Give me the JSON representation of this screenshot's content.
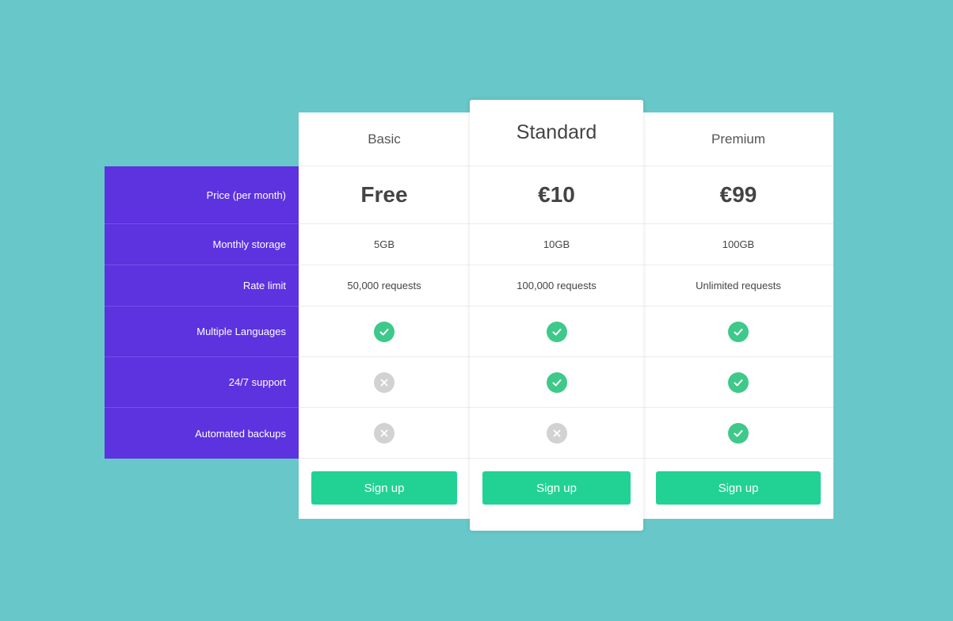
{
  "colors": {
    "background": "#68c7c8",
    "label_column": "#5d32df",
    "cta": "#22d294",
    "check": "#3ec98a",
    "cross": "#d2d2d2"
  },
  "feature_labels": {
    "price": "Price (per month)",
    "storage": "Monthly storage",
    "rate_limit": "Rate limit",
    "languages": "Multiple Languages",
    "support": "24/7 support",
    "backups": "Automated backups"
  },
  "plans": {
    "basic": {
      "name": "Basic",
      "price": "Free",
      "storage": "5GB",
      "rate_limit": "50,000 requests",
      "languages": "check-icon",
      "support": "cross-icon",
      "backups": "cross-icon",
      "cta_label": "Sign up"
    },
    "standard": {
      "name": "Standard",
      "price": "€10",
      "storage": "10GB",
      "rate_limit": "100,000 requests",
      "languages": "check-icon",
      "support": "check-icon",
      "backups": "cross-icon",
      "cta_label": "Sign up"
    },
    "premium": {
      "name": "Premium",
      "price": "€99",
      "storage": "100GB",
      "rate_limit": "Unlimited requests",
      "languages": "check-icon",
      "support": "check-icon",
      "backups": "check-icon",
      "cta_label": "Sign up"
    }
  }
}
